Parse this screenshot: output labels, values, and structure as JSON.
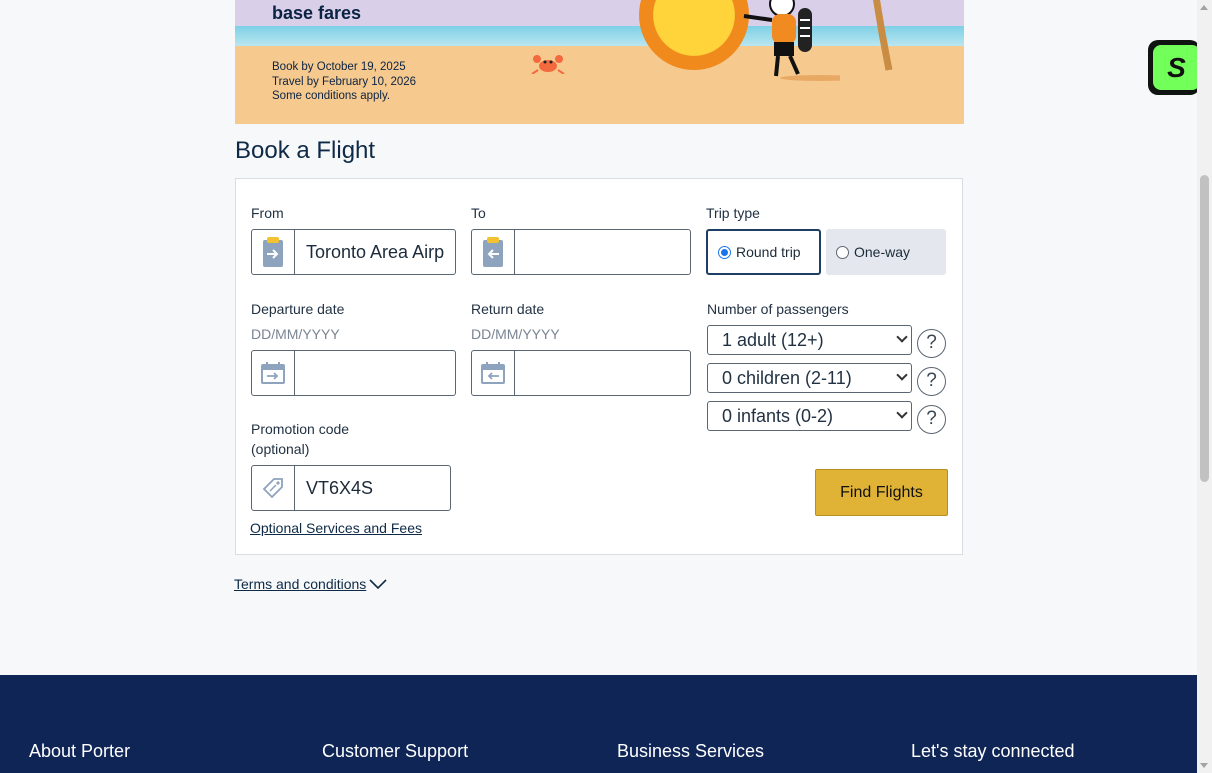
{
  "banner": {
    "headline": "base fares",
    "book_by": "Book by October 19, 2025",
    "travel_by": "Travel by February 10, 2026",
    "conditions": "Some conditions apply."
  },
  "side_tab": {
    "label": "S"
  },
  "page_title": "Book a Flight",
  "form": {
    "from": {
      "label": "From",
      "value": "Toronto Area Airp",
      "icon": "airport-departure-icon"
    },
    "to": {
      "label": "To",
      "value": "",
      "icon": "airport-arrival-icon"
    },
    "trip_type": {
      "label": "Trip type",
      "options": [
        "Round trip",
        "One-way"
      ],
      "selected": "Round trip"
    },
    "departure": {
      "label": "Departure date",
      "format_hint": "DD/MM/YYYY",
      "value": "",
      "icon": "calendar-departure-icon"
    },
    "return": {
      "label": "Return date",
      "format_hint": "DD/MM/YYYY",
      "value": "",
      "icon": "calendar-return-icon"
    },
    "passengers": {
      "label": "Number of passengers",
      "adults": "1 adult (12+)",
      "children": "0 children (2-11)",
      "infants": "0 infants (0-2)",
      "help": "?"
    },
    "promo": {
      "label_line1": "Promotion code",
      "label_line2": "(optional)",
      "value": "VT6X4S",
      "icon": "tag-icon"
    },
    "find_button": "Find Flights",
    "services_link": "Optional Services and Fees"
  },
  "terms_link": "Terms and conditions",
  "footer": {
    "columns": [
      "About Porter",
      "Customer Support",
      "Business Services",
      "Let's stay connected"
    ]
  },
  "colors": {
    "button": "#e0b336",
    "footer": "#0f2556",
    "selected_option_border": "#1f3e66",
    "unselected_option_bg": "#e4e7ee"
  }
}
